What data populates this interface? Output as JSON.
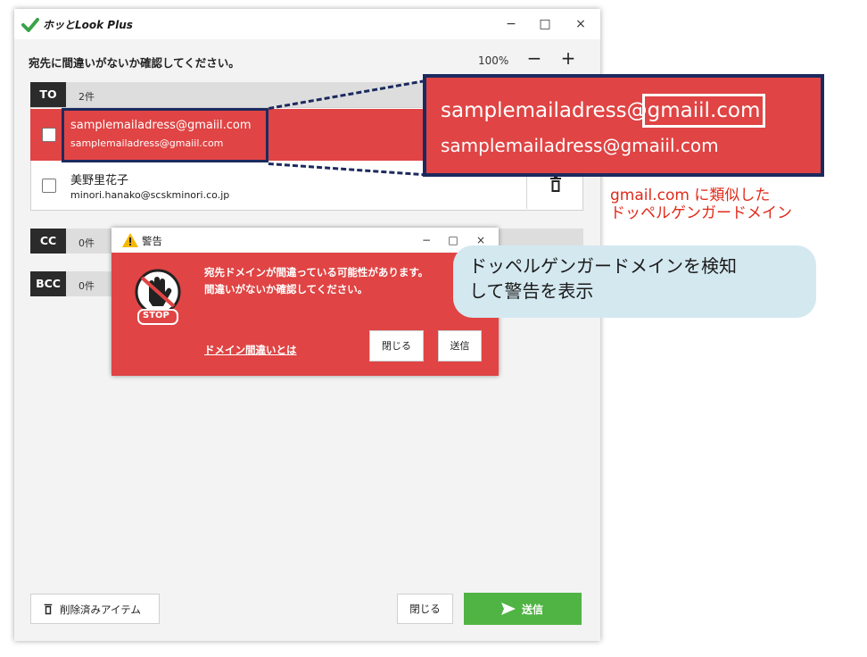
{
  "app": {
    "title": "ホッとLook Plus"
  },
  "window_controls": {
    "minimize": "−",
    "maximize": "□",
    "close": "×"
  },
  "header": {
    "prompt": "宛先に間違いがないか確認してください。",
    "zoom_level": "100%",
    "zoom_out": "−",
    "zoom_in": "+"
  },
  "to": {
    "tag": "TO",
    "count": "2件",
    "recipients": [
      {
        "name": "samplemailadress@gmaiil.com",
        "email": "samplemailadress@gmaiil.com",
        "highlighted": true
      },
      {
        "name": "美野里花子",
        "email": "minori.hanako@scskminori.co.jp",
        "highlighted": false
      }
    ]
  },
  "cc": {
    "tag": "CC",
    "count": "0件"
  },
  "bcc": {
    "tag": "BCC",
    "count": "0件"
  },
  "footer": {
    "deleted_items": "削除済みアイテム",
    "close": "閉じる",
    "send": "送信"
  },
  "zoom_callout": {
    "line1_prefix": "samplemailadress@",
    "line1_domain": "gmaiil.com",
    "line2": "samplemailadress@gmaiil.com"
  },
  "annotation": {
    "note_line1": "gmail.com に類似した",
    "note_line2": "ドッペルゲンガードメイン",
    "bubble_line1": "ドッペルゲンガードメインを検知",
    "bubble_line2": "して警告を表示"
  },
  "warning_dialog": {
    "title": "警告",
    "message_line1": "宛先ドメインが間違っている可能性があります。",
    "message_line2": "間違いがないか確認してください。",
    "stop_label": "STOP",
    "help_link": "ドメイン間違いとは",
    "close": "閉じる",
    "send": "送信"
  },
  "colors": {
    "accent_red": "#e04444",
    "send_green": "#4fb443",
    "frame_navy": "#1b2a5e",
    "note_red": "#e02a1a",
    "bubble_blue": "#d4e8f0"
  },
  "icons": [
    "app-logo-icon",
    "trash-icon",
    "send-arrow-icon",
    "warning-icon",
    "stop-hand-icon"
  ]
}
